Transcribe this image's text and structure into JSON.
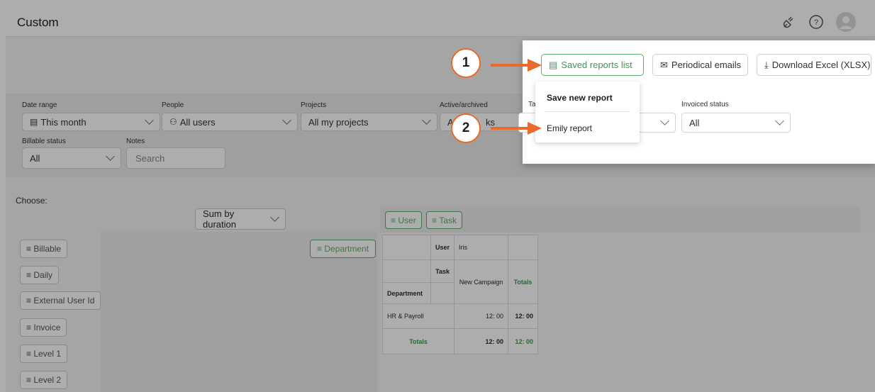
{
  "header": {
    "title": "Custom",
    "icons": [
      "plug-icon",
      "help-icon",
      "user-avatar-icon"
    ]
  },
  "filters": {
    "date_range": {
      "label": "Date range",
      "value": "This month",
      "icon": "calendar-icon"
    },
    "people": {
      "label": "People",
      "value": "All users",
      "icon": "users-icon"
    },
    "projects": {
      "label": "Projects",
      "value": "All my projects"
    },
    "active_archived": {
      "label": "Active/archived",
      "value_partial_left": "A",
      "value_partial_right": "ks"
    },
    "tags_label_partial": "Ta",
    "invoiced_status": {
      "label": "Invoiced status",
      "value": "All"
    },
    "billable_status": {
      "label": "Billable status",
      "value": "All"
    },
    "notes": {
      "label": "Notes",
      "placeholder": "Search"
    }
  },
  "actions": {
    "saved_reports": "Saved reports list",
    "periodical_emails": "Periodical emails",
    "download_excel": "Download Excel (XLSX)"
  },
  "saved_reports_menu": {
    "save_new": "Save new report",
    "items": [
      "Emily report"
    ]
  },
  "builder": {
    "choose_label": "Choose:",
    "sum_select": "Sum by duration",
    "available_fields": [
      "Billable",
      "Daily",
      "External User Id",
      "Invoice",
      "Level 1",
      "Level 2"
    ],
    "row_fields": [
      "Department"
    ],
    "column_fields": [
      "User",
      "Task"
    ],
    "chip_prefix": "≡"
  },
  "pivot": {
    "user_header": "User",
    "user_value": "Iris",
    "task_header": "Task",
    "task_value": "New Campaign",
    "department_header": "Department",
    "totals_label": "Totals",
    "rows": [
      {
        "department": "HR & Payroll",
        "value": "12: 00",
        "total": "12: 00"
      }
    ],
    "totals_row": {
      "value": "12: 00",
      "total": "12: 00"
    }
  },
  "annotations": {
    "step1": "1",
    "step2": "2",
    "accent_color": "#ea6a2c"
  },
  "colors": {
    "green_accent": "#5cae6f"
  }
}
